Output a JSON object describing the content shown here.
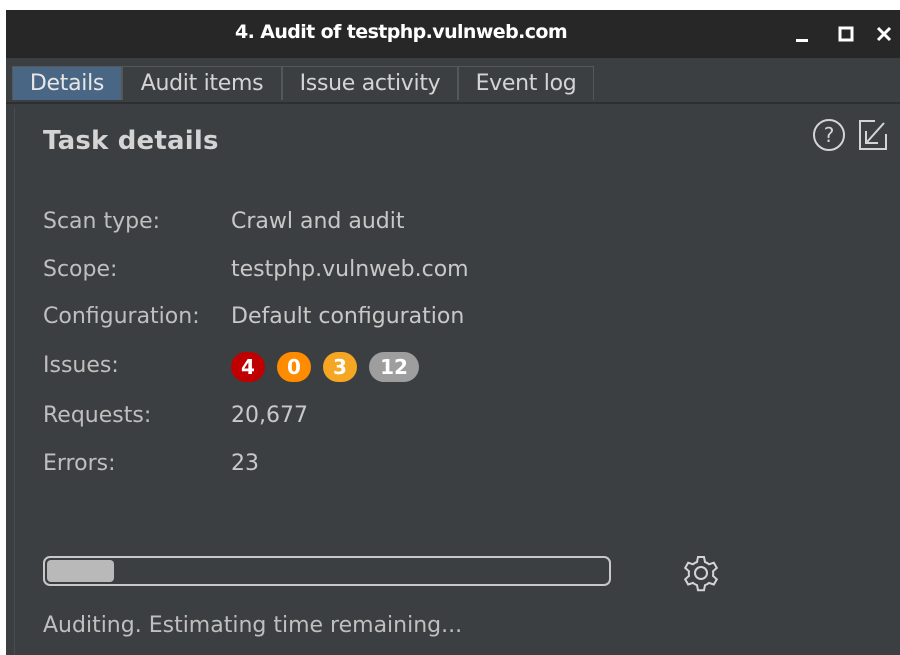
{
  "window": {
    "title": "4. Audit of testphp.vulnweb.com",
    "controls": [
      "minimize-icon",
      "maximize-icon",
      "close-icon"
    ]
  },
  "tabs": [
    {
      "label": "Details",
      "active": true
    },
    {
      "label": "Audit items",
      "active": false
    },
    {
      "label": "Issue activity",
      "active": false
    },
    {
      "label": "Event log",
      "active": false
    }
  ],
  "details": {
    "heading": "Task details",
    "icons": [
      "help-icon",
      "popout-icon"
    ],
    "rows": [
      {
        "label": "Scan type:",
        "value": "Crawl and audit"
      },
      {
        "label": "Scope:",
        "value": "testphp.vulnweb.com"
      },
      {
        "label": "Configuration:",
        "value": "Default configuration"
      },
      {
        "label": "Issues:",
        "value": ""
      },
      {
        "label": "Requests:",
        "value": "20,677"
      },
      {
        "label": "Errors:",
        "value": "23"
      }
    ],
    "issues": [
      {
        "count": "4",
        "severity": "high",
        "color": "#c00000"
      },
      {
        "count": "0",
        "severity": "medium",
        "color": "#ff8c00"
      },
      {
        "count": "3",
        "severity": "low",
        "color": "#f5a623"
      },
      {
        "count": "12",
        "severity": "info",
        "color": "#9e9e9e"
      }
    ]
  },
  "progress": {
    "fraction": 0.12,
    "status": "Auditing. Estimating time remaining..."
  },
  "colors": {
    "titlebar": "#272727",
    "panel": "#3c3f41",
    "active_tab": "#4a6685"
  }
}
